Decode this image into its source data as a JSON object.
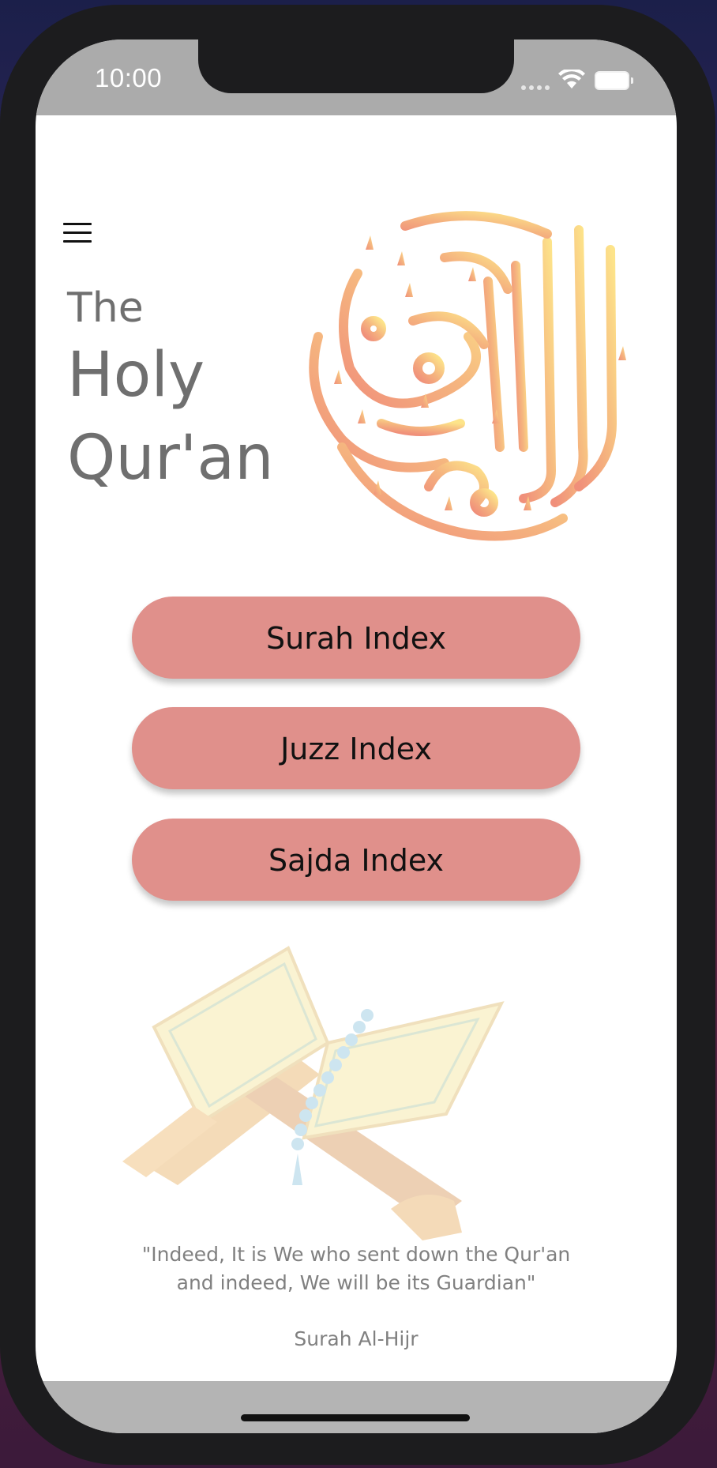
{
  "status_bar": {
    "time": "10:00"
  },
  "header": {
    "title_line1": "The",
    "title_line2": "Holy",
    "title_line3": "Qur'an"
  },
  "menu": [
    {
      "label": "Surah Index"
    },
    {
      "label": "Juzz Index"
    },
    {
      "label": "Sajda Index"
    }
  ],
  "footer": {
    "quote_line1": "\"Indeed, It is We who sent down the Qur'an",
    "quote_line2": "and indeed, We will be its Guardian\"",
    "source": "Surah Al-Hijr"
  },
  "colors": {
    "button": "#e0908b",
    "title_text": "#6f6f6f",
    "calligraphy_start": "#f08f7a",
    "calligraphy_end": "#fde48a"
  },
  "icons": {
    "menu": "hamburger-icon",
    "wifi": "wifi-icon",
    "battery": "battery-icon"
  }
}
